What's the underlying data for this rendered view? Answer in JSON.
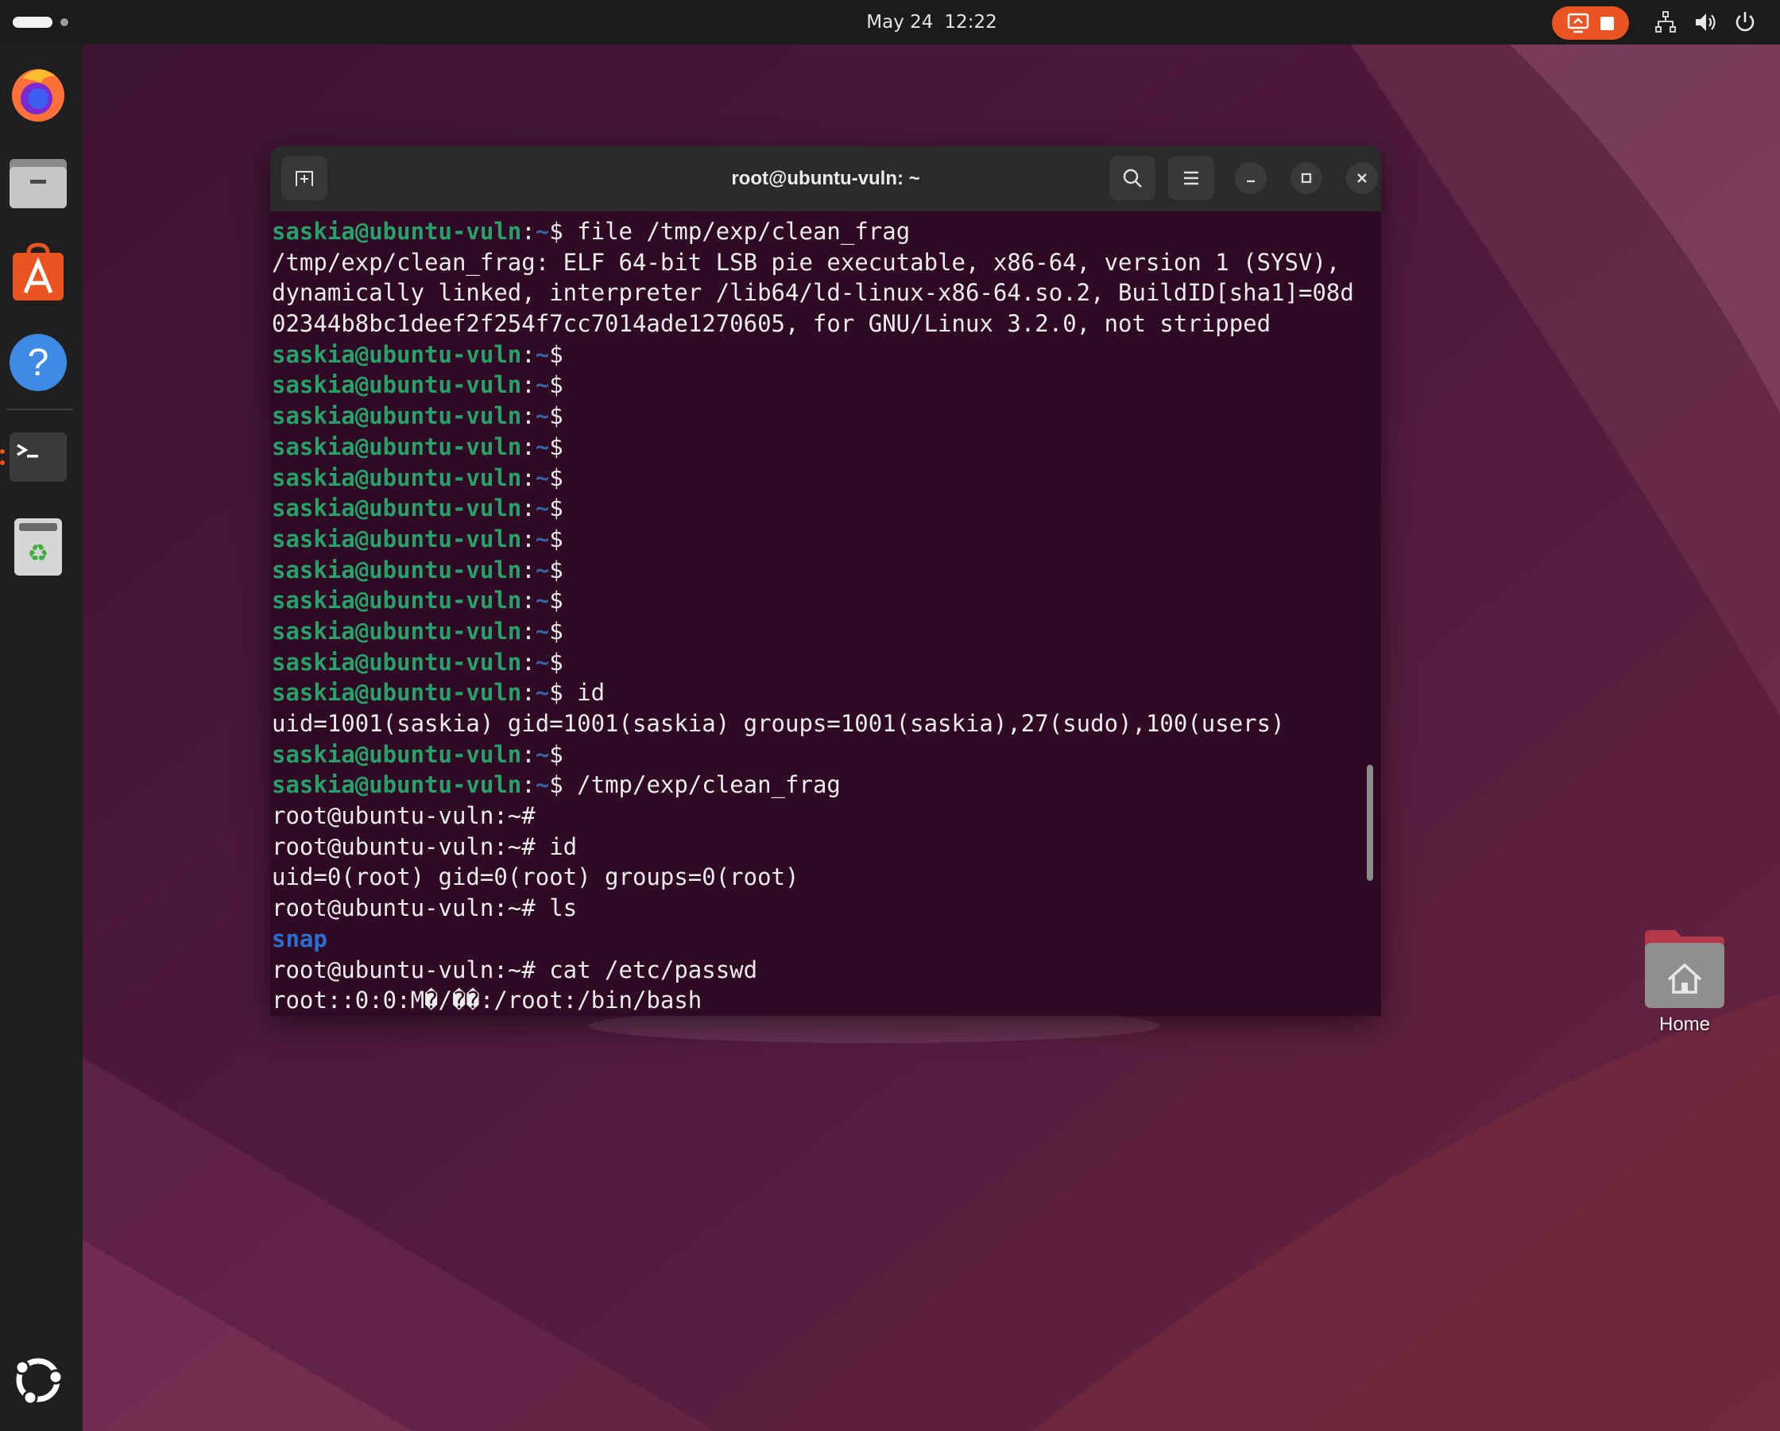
{
  "topbar": {
    "date": "May 24",
    "time": "12:22"
  },
  "dock": {
    "apps": [
      "firefox-icon",
      "files-icon",
      "app-center-icon",
      "help-icon",
      "terminal-icon",
      "trash-icon"
    ],
    "show_apps": "ubuntu-logo-icon"
  },
  "terminal": {
    "title": "root@ubuntu-vuln: ~",
    "prompt_user": "saskia@ubuntu-vuln",
    "prompt_dir": "~",
    "lines": {
      "l0_cmd": " file /tmp/exp/clean_frag",
      "l1": "/tmp/exp/clean_frag: ELF 64-bit LSB pie executable, x86-64, version 1 (SYSV),",
      "l2": "dynamically linked, interpreter /lib64/ld-linux-x86-64.so.2, BuildID[sha1]=08d",
      "l3": "02344b8bc1deef2f254f7cc7014ade1270605, for GNU/Linux 3.2.0, not stripped",
      "l15_cmd": " id",
      "l16": "uid=1001(saskia) gid=1001(saskia) groups=1001(saskia),27(sudo),100(users)",
      "l18_cmd": " /tmp/exp/clean_frag",
      "l19": "root@ubuntu-vuln:~#",
      "l20": "root@ubuntu-vuln:~# id",
      "l21": "uid=0(root) gid=0(root) groups=0(root)",
      "l22": "root@ubuntu-vuln:~# ls",
      "l23": "snap",
      "l24": "root@ubuntu-vuln:~# cat /etc/passwd",
      "l25": "root::0:0:M�/��:/root:/bin/bash"
    }
  },
  "desktop": {
    "home_label": "Home"
  },
  "colors": {
    "accent": "#e95420",
    "terminal_bg": "#300a24",
    "prompt_green": "#26a269",
    "prompt_blue": "#3465a4"
  }
}
